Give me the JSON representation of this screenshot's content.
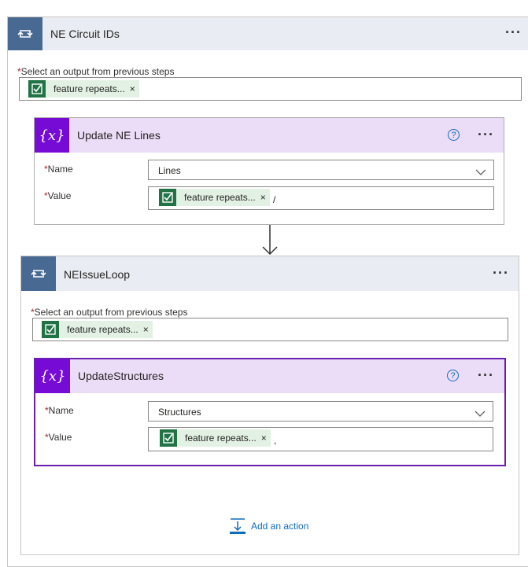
{
  "outer_loop": {
    "title": "NE Circuit IDs",
    "more": "···",
    "select_label": "Select an output from previous steps",
    "token": "feature repeats...",
    "token_remove": "×"
  },
  "update_ne_lines": {
    "title": "Update NE Lines",
    "help": "?",
    "more": "···",
    "name_label": "Name",
    "name_value": "Lines",
    "value_label": "Value",
    "value_token": "feature repeats...",
    "token_remove": "×",
    "value_suffix": "/"
  },
  "connector_arrow": "↓",
  "inner_loop": {
    "title": "NEIssueLoop",
    "more": "···",
    "select_label": "Select an output from previous steps",
    "token": "feature repeats...",
    "token_remove": "×"
  },
  "update_structures": {
    "title": "UpdateStructures",
    "help": "?",
    "more": "···",
    "name_label": "Name",
    "name_value": "Structures",
    "value_label": "Value",
    "value_token": "feature repeats...",
    "token_remove": "×",
    "value_suffix": ","
  },
  "add_action": {
    "label": "Add an action"
  },
  "required_mark": "*",
  "icons": {
    "loop": "loop-icon",
    "variable": "variable-icon",
    "token": "excel-forms-icon",
    "chevron": "chevron-down-icon",
    "add_action": "add-action-icon",
    "help": "help-icon"
  },
  "colors": {
    "loop_icon_bg": "#486991",
    "variable_icon_bg": "#770bd6",
    "variable_header_bg": "#ebdcf7",
    "loop_header_bg": "#e9ecf2",
    "token_icon_bg": "#217346",
    "token_bg": "#e3f1e4",
    "link": "#0f6cbd",
    "required": "#a4262c",
    "selected_border": "#6b1fb0"
  }
}
